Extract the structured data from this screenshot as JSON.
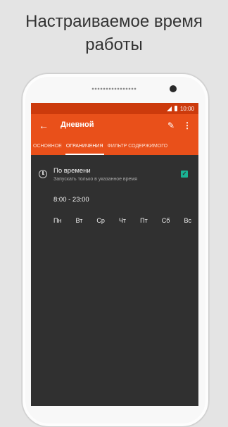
{
  "headline": {
    "line1": "Настраиваемое время",
    "line2": "работы"
  },
  "status_bar": {
    "time": "10:00"
  },
  "app_bar": {
    "title": "Дневной",
    "icons": [
      "back-arrow-icon",
      "edit-pencil-icon",
      "more-vert-icon"
    ]
  },
  "tabs": [
    {
      "label": "ОСНОВНОЕ",
      "active": false
    },
    {
      "label": "ОГРАНИЧЕНИЯ",
      "active": true
    },
    {
      "label": "ФИЛЬТР СОДЕРЖИМОГО",
      "active": false
    }
  ],
  "restriction": {
    "title": "По времени",
    "subtitle": "Запускать только в указанное время",
    "checked": true,
    "check_mark": "✓",
    "time_range": "8:00 - 23:00",
    "days": [
      "Пн",
      "Вт",
      "Ср",
      "Чт",
      "Пт",
      "Сб",
      "Вс"
    ]
  },
  "colors": {
    "accent": "#e9501a",
    "status_bar": "#cc3a0c",
    "background": "#303030",
    "checkbox": "#1ab394"
  }
}
